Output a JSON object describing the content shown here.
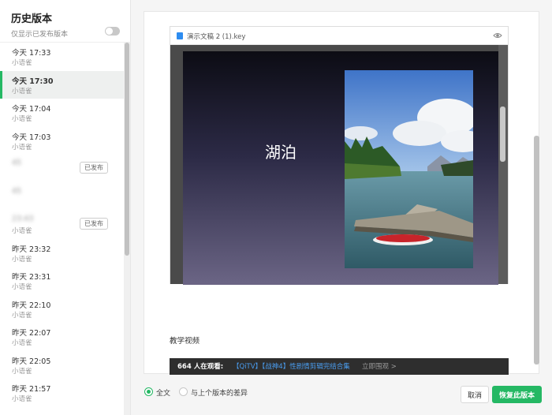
{
  "sidebar": {
    "title": "历史版本",
    "filter_label": "仅显示已发布版本",
    "filter_enabled": false,
    "versions": [
      {
        "time": "今天 17:33",
        "author": "小语雀",
        "badge": "",
        "blurred": false
      },
      {
        "time": "今天 17:30",
        "author": "小语雀",
        "badge": "",
        "blurred": false,
        "selected": true
      },
      {
        "time": "今天 17:04",
        "author": "小语雀",
        "badge": "",
        "blurred": false
      },
      {
        "time": "今天 17:03",
        "author": "小语雀",
        "badge": "",
        "blurred": false
      },
      {
        "time": "45",
        "author": "",
        "badge": "已发布",
        "blurred": true
      },
      {
        "time": "45",
        "author": "",
        "badge": "",
        "blurred": true
      },
      {
        "time": "23:43",
        "author": "小语雀",
        "badge": "已发布",
        "blurred": true
      },
      {
        "time": "昨天 23:32",
        "author": "小语雀",
        "badge": "",
        "blurred": false
      },
      {
        "time": "昨天 23:31",
        "author": "小语雀",
        "badge": "",
        "blurred": false
      },
      {
        "time": "昨天 22:10",
        "author": "小语雀",
        "badge": "",
        "blurred": false
      },
      {
        "time": "昨天 22:07",
        "author": "小语雀",
        "badge": "",
        "blurred": false
      },
      {
        "time": "昨天 22:05",
        "author": "小语雀",
        "badge": "",
        "blurred": false
      },
      {
        "time": "昨天 21:57",
        "author": "小语雀",
        "badge": "",
        "blurred": false
      }
    ]
  },
  "document": {
    "file_name": "演示文稿 2 (1).key",
    "file_icon": "keynote-file-icon",
    "slide_title": "湖泊",
    "section_label": "教学视频",
    "video_bar": {
      "viewers": "664 人在观看:",
      "link": "【QiTV】【战神4】性剧情剪辑完结合集",
      "watch": "立即围观 >"
    }
  },
  "footer": {
    "radio_full": "全文",
    "radio_diff": "与上个版本的差异",
    "selected_mode": "full",
    "cancel_label": "取消",
    "restore_label": "恢复此版本"
  },
  "colors": {
    "accent": "#25b864",
    "link": "#4a9df0"
  }
}
